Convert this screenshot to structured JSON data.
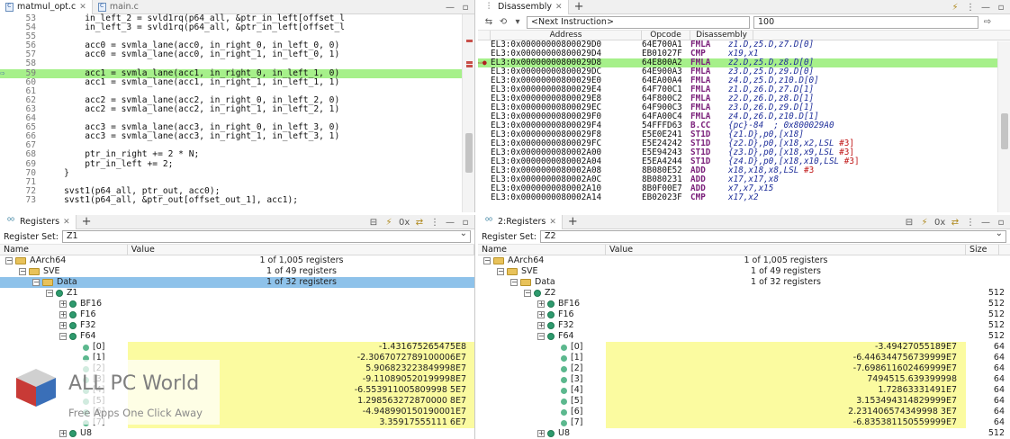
{
  "editor": {
    "tabs": [
      {
        "label": "matmul_opt.c"
      },
      {
        "label": "main.c"
      }
    ],
    "lines": [
      {
        "num": "53",
        "text": "        in_left_2 = svld1rq(p64_all, &ptr_in_left[offset_l"
      },
      {
        "num": "54",
        "text": "        in_left_3 = svld1rq(p64_all, &ptr_in_left[offset_l"
      },
      {
        "num": "55",
        "text": ""
      },
      {
        "num": "56",
        "text": "        acc0 = svmla_lane(acc0, in_right_0, in_left_0, 0)"
      },
      {
        "num": "57",
        "text": "        acc0 = svmla_lane(acc0, in_right_1, in_left_0, 1)"
      },
      {
        "num": "58",
        "text": ""
      },
      {
        "num": "59",
        "text": "        acc1 = svmla_lane(acc1, in_right_0, in_left_1, 0)"
      },
      {
        "num": "60",
        "text": "        acc1 = svmla_lane(acc1, in_right_1, in_left_1, 1)"
      },
      {
        "num": "61",
        "text": ""
      },
      {
        "num": "62",
        "text": "        acc2 = svmla_lane(acc2, in_right_0, in_left_2, 0)"
      },
      {
        "num": "63",
        "text": "        acc2 = svmla_lane(acc2, in_right_1, in_left_2, 1)"
      },
      {
        "num": "64",
        "text": ""
      },
      {
        "num": "65",
        "text": "        acc3 = svmla_lane(acc3, in_right_0, in_left_3, 0)"
      },
      {
        "num": "66",
        "text": "        acc3 = svmla_lane(acc3, in_right_1, in_left_3, 1)"
      },
      {
        "num": "67",
        "text": ""
      },
      {
        "num": "68",
        "text": "        ptr_in_right += 2 * N;"
      },
      {
        "num": "69",
        "text": "        ptr_in_left += 2;"
      },
      {
        "num": "70",
        "text": "    }"
      },
      {
        "num": "71",
        "text": ""
      },
      {
        "num": "72",
        "text": "    svst1(p64_all, ptr_out, acc0);"
      },
      {
        "num": "73",
        "text": "    svst1(p64_all, &ptr_out[offset_out_1], acc1);"
      }
    ]
  },
  "disassembly": {
    "tab_label": "Disassembly",
    "location": "<Next Instruction>",
    "count": "100",
    "columns": [
      "Address",
      "Opcode",
      "Disassembly"
    ],
    "rows": [
      {
        "addr": "EL3:0x00000000800029D0",
        "op": "64E700A1",
        "mn": "FMLA",
        "args": "z1.D,z5.D,z7.D[0]"
      },
      {
        "addr": "EL3:0x00000000800029D4",
        "op": "EB01027F",
        "mn": "CMP",
        "args": "x19,x1"
      },
      {
        "addr": "EL3:0x00000000800029D8",
        "op": "64E800A2",
        "mn": "FMLA",
        "args": "z2.D,z5.D,z8.D[0]"
      },
      {
        "addr": "EL3:0x00000000800029DC",
        "op": "64E900A3",
        "mn": "FMLA",
        "args": "z3.D,z5.D,z9.D[0]"
      },
      {
        "addr": "EL3:0x00000000800029E0",
        "op": "64EA00A4",
        "mn": "FMLA",
        "args": "z4.D,z5.D,z10.D[0]"
      },
      {
        "addr": "EL3:0x00000000800029E4",
        "op": "64F700C1",
        "mn": "FMLA",
        "args": "z1.D,z6.D,z7.D[1]"
      },
      {
        "addr": "EL3:0x00000000800029E8",
        "op": "64F800C2",
        "mn": "FMLA",
        "args": "z2.D,z6.D,z8.D[1]"
      },
      {
        "addr": "EL3:0x00000000800029EC",
        "op": "64F900C3",
        "mn": "FMLA",
        "args": "z3.D,z6.D,z9.D[1]"
      },
      {
        "addr": "EL3:0x00000000800029F0",
        "op": "64FA00C4",
        "mn": "FMLA",
        "args": "z4.D,z6.D,z10.D[1]"
      },
      {
        "addr": "EL3:0x00000000800029F4",
        "op": "54FFFD63",
        "mn": "B.CC",
        "args": "{pc}-84  ; 0x800029A0"
      },
      {
        "addr": "EL3:0x00000000800029F8",
        "op": "E5E0E241",
        "mn": "ST1D",
        "args": "{z1.D},p0,[x18]"
      },
      {
        "addr": "EL3:0x00000000800029FC",
        "op": "E5E24242",
        "mn": "ST1D",
        "args": "{z2.D},p0,[x18,x2,LSL ",
        "imm": "#3]"
      },
      {
        "addr": "EL3:0x0000000080002A00",
        "op": "E5E94243",
        "mn": "ST1D",
        "args": "{z3.D},p0,[x18,x9,LSL ",
        "imm": "#3]"
      },
      {
        "addr": "EL3:0x0000000080002A04",
        "op": "E5EA4244",
        "mn": "ST1D",
        "args": "{z4.D},p0,[x18,x10,LSL ",
        "imm": "#3]"
      },
      {
        "addr": "EL3:0x0000000080002A08",
        "op": "8B080E52",
        "mn": "ADD",
        "args": "x18,x18,x8,LSL ",
        "imm": "#3"
      },
      {
        "addr": "EL3:0x0000000080002A0C",
        "op": "8B080231",
        "mn": "ADD",
        "args": "x17,x17,x8"
      },
      {
        "addr": "EL3:0x0000000080002A10",
        "op": "8B0F00E7",
        "mn": "ADD",
        "args": "x7,x7,x15"
      },
      {
        "addr": "EL3:0x0000000080002A14",
        "op": "EB02023F",
        "mn": "CMP",
        "args": "x17,x2"
      }
    ]
  },
  "reg1": {
    "tab_label": "Registers",
    "set_label": "Register Set:",
    "set_value": "Z1",
    "columns": [
      "Name",
      "Value"
    ],
    "rows": [
      {
        "name": "AArch64",
        "value": "1 of 1,005 registers"
      },
      {
        "name": "SVE",
        "value": "1 of 49 registers"
      },
      {
        "name": "Data",
        "value": "1 of 32 registers"
      },
      {
        "name": "Z1",
        "value": ""
      },
      {
        "name": "BF16",
        "value": ""
      },
      {
        "name": "F16",
        "value": ""
      },
      {
        "name": "F32",
        "value": ""
      },
      {
        "name": "F64",
        "value": ""
      },
      {
        "name": "[0]",
        "value": "-1.431675265475E8"
      },
      {
        "name": "[1]",
        "value": "-2.3067072789100006E7"
      },
      {
        "name": "[2]",
        "value": "5.906823223849998E7"
      },
      {
        "name": "[3]",
        "value": "-9.110890520199998E7"
      },
      {
        "name": "[4]",
        "value": "-6.553911005809998 5E7"
      },
      {
        "name": "[5]",
        "value": "1.298563272870000 8E7"
      },
      {
        "name": "[6]",
        "value": "-4.948990150190001E7"
      },
      {
        "name": "[7]",
        "value": "3.35917555111 6E7"
      },
      {
        "name": "U8",
        "value": ""
      }
    ]
  },
  "reg2": {
    "tab_label": "2:Registers",
    "set_label": "Register Set:",
    "set_value": "Z2",
    "columns": [
      "Name",
      "Value",
      "Size"
    ],
    "rows": [
      {
        "name": "AArch64",
        "value": "1 of 1,005 registers",
        "size": ""
      },
      {
        "name": "SVE",
        "value": "1 of 49 registers",
        "size": ""
      },
      {
        "name": "Data",
        "value": "1 of 32 registers",
        "size": ""
      },
      {
        "name": "Z2",
        "value": "",
        "size": "512"
      },
      {
        "name": "BF16",
        "value": "",
        "size": "512"
      },
      {
        "name": "F16",
        "value": "",
        "size": "512"
      },
      {
        "name": "F32",
        "value": "",
        "size": "512"
      },
      {
        "name": "F64",
        "value": "",
        "size": "512"
      },
      {
        "name": "[0]",
        "value": "-3.49427055189E7",
        "size": "64"
      },
      {
        "name": "[1]",
        "value": "-6.446344756739999E7",
        "size": "64"
      },
      {
        "name": "[2]",
        "value": "-7.698611602469999E7",
        "size": "64"
      },
      {
        "name": "[3]",
        "value": "7494515.639399998",
        "size": "64"
      },
      {
        "name": "[4]",
        "value": "1.72863331491E7",
        "size": "64"
      },
      {
        "name": "[5]",
        "value": "3.153494314829999E7",
        "size": "64"
      },
      {
        "name": "[6]",
        "value": "2.231406574349998 3E7",
        "size": "64"
      },
      {
        "name": "[7]",
        "value": "-6.835381150559999E7",
        "size": "64"
      },
      {
        "name": "U8",
        "value": "",
        "size": "512"
      }
    ]
  },
  "watermark": {
    "title": "ALL PC World",
    "subtitle": "Free Apps One Click Away"
  },
  "icons": [
    "c-file-icon",
    "disassembly-icon",
    "registers-icon",
    "folder-icon",
    "register-dot-icon",
    "program-counter-arrow-icon"
  ]
}
